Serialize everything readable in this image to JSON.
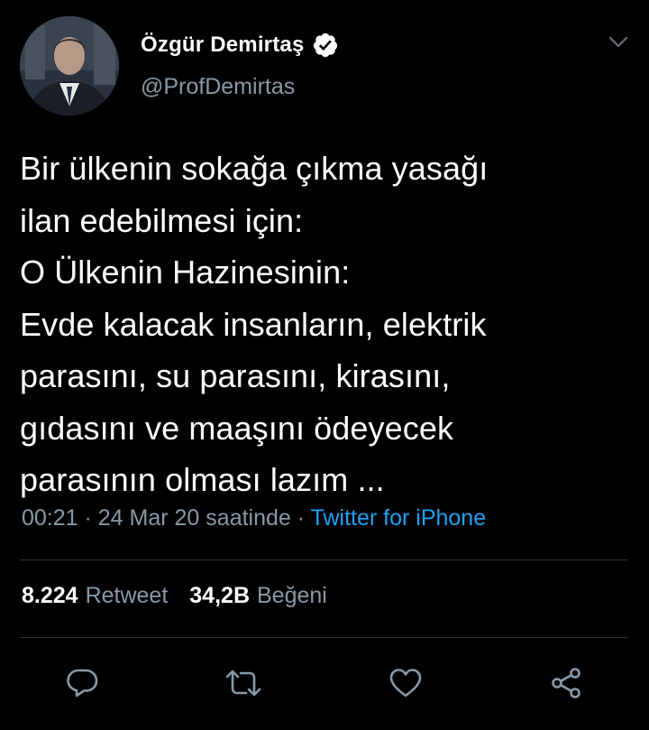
{
  "tweet": {
    "author": {
      "display_name": "Özgür Demirtaş",
      "handle": "@ProfDemirtas",
      "verified": true
    },
    "text_lines": [
      "Bir ülkenin sokağa çıkma yasağı",
      "ilan edebilmesi için:",
      "O Ülkenin Hazinesinin:",
      "Evde kalacak insanların, elektrik",
      "parasını, su parasını, kirasını,",
      "gıdasını ve maaşını ödeyecek",
      "parasının olması lazım ..."
    ],
    "timestamp": "00:21 · 24 Mar 20 saatinde · ",
    "source": "Twitter for iPhone",
    "stats": {
      "retweets_count": "8.224",
      "retweets_label": "Retweet",
      "likes_count": "34,2B",
      "likes_label": "Beğeni"
    }
  },
  "icons": {
    "menu": "chevron-down-icon",
    "verified": "verified-badge-icon",
    "reply": "reply-icon",
    "retweet": "retweet-icon",
    "like": "heart-icon",
    "share": "share-icon"
  },
  "colors": {
    "background": "#000000",
    "text_primary": "#ffffff",
    "text_secondary": "#8899a6",
    "link": "#1da1f2",
    "divider": "#2f3336"
  }
}
